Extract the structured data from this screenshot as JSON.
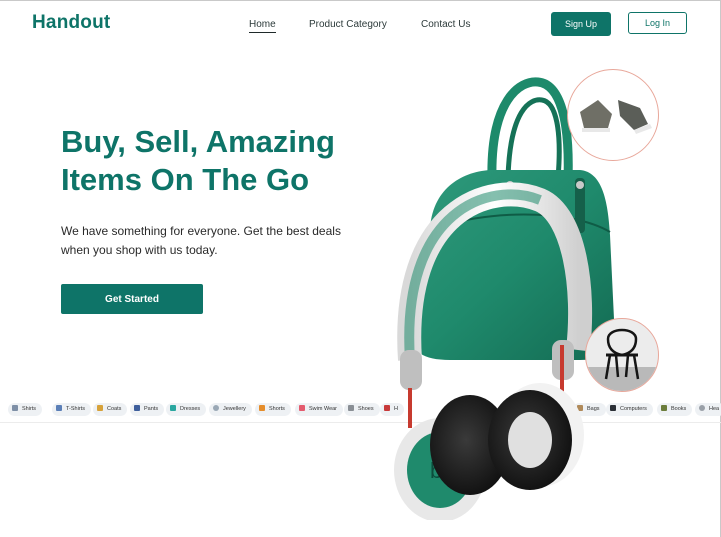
{
  "brand": {
    "name": "Handout",
    "accent": "#0e7468"
  },
  "nav": {
    "links": [
      {
        "label": "Home",
        "active": true
      },
      {
        "label": "Product Category",
        "active": false
      },
      {
        "label": "Contact Us",
        "active": false
      }
    ],
    "signup_label": "Sign Up",
    "login_label": "Log In"
  },
  "hero": {
    "title_line1": "Buy, Sell, Amazing",
    "title_line2": "Items On The Go",
    "subtitle": "We have something for everyone. Get the best deals when you shop with us today.",
    "cta_label": "Get Started"
  },
  "categories": [
    {
      "label": "Shirts",
      "icon": "shirt-icon"
    },
    {
      "label": "T-Shirts",
      "icon": "tshirt-icon"
    },
    {
      "label": "Coats",
      "icon": "coat-icon"
    },
    {
      "label": "Pants",
      "icon": "pants-icon"
    },
    {
      "label": "Dresses",
      "icon": "dress-icon"
    },
    {
      "label": "Jewellery",
      "icon": "jewellery-icon"
    },
    {
      "label": "Shorts",
      "icon": "shorts-icon"
    },
    {
      "label": "Swim Wear",
      "icon": "swimwear-icon"
    },
    {
      "label": "Shoes",
      "icon": "shoe-icon"
    },
    {
      "label": "H",
      "icon": "heels-icon"
    },
    {
      "label": "Bags",
      "icon": "bag-icon"
    },
    {
      "label": "Computers",
      "icon": "computer-icon"
    },
    {
      "label": "Books",
      "icon": "book-icon"
    },
    {
      "label": "Hea",
      "icon": "headphones-icon"
    }
  ],
  "images": {
    "handbag": "green-handbag-image",
    "headphones": "white-headphones-image",
    "shoes": "sneakers-image",
    "chair": "black-chair-image"
  }
}
